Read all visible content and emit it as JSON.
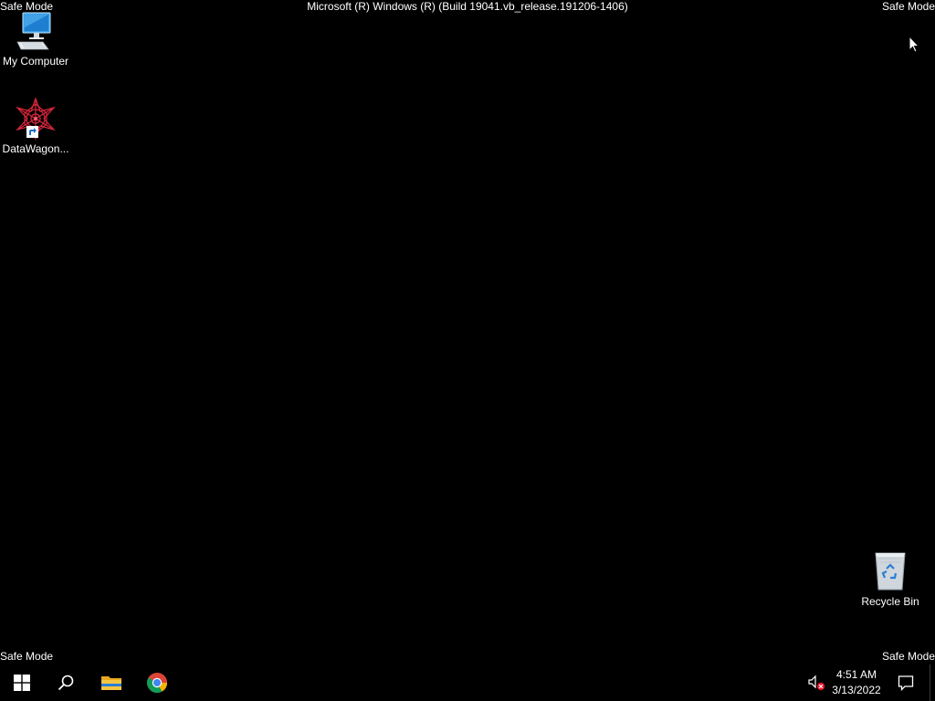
{
  "watermarks": {
    "top_left": "Safe Mode",
    "top_right": "Safe Mode",
    "bottom_left": "Safe Mode",
    "bottom_right": "Safe Mode",
    "build": "Microsoft (R) Windows (R) (Build 19041.vb_release.191206-1406)"
  },
  "desktop_icons": {
    "my_computer": {
      "label": "My Computer",
      "icon": "computer-icon"
    },
    "datawagon": {
      "label": "DataWagon...",
      "icon": "datawagon-icon"
    },
    "recycle_bin": {
      "label": "Recycle Bin",
      "icon": "recycle-bin-icon"
    }
  },
  "taskbar": {
    "start": {
      "icon": "windows-logo-icon"
    },
    "search": {
      "icon": "search-icon"
    },
    "file_explorer": {
      "icon": "folder-icon"
    },
    "chrome": {
      "icon": "chrome-icon"
    },
    "tray": {
      "volume": {
        "icon": "volume-muted-icon"
      },
      "time": "4:51 AM",
      "date": "3/13/2022",
      "notifications": {
        "icon": "action-center-icon"
      }
    }
  },
  "colors": {
    "background": "#000000",
    "text": "#ffffff",
    "windows_blue": "#00a2ed",
    "folder_yellow": "#f5c542",
    "mute_red": "#e81123"
  }
}
